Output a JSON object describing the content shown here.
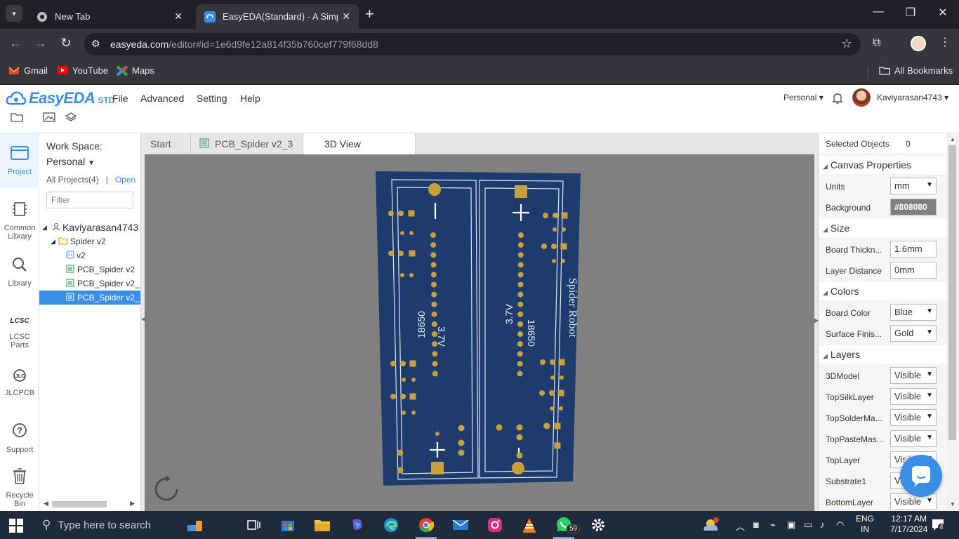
{
  "browser": {
    "tabs": [
      {
        "title": "New Tab",
        "active": false
      },
      {
        "title": "EasyEDA(Standard) - A Simple a",
        "active": true
      }
    ],
    "url_host": "easyeda.com",
    "url_path": "/editor#id=1e6d9fe12a814f35b760cef779f68dd8",
    "bookmarks": [
      "Gmail",
      "YouTube",
      "Maps"
    ],
    "all_bookmarks": "All Bookmarks"
  },
  "app": {
    "logo": "EasyEDA",
    "edition": "STD",
    "menu": [
      "File",
      "Advanced",
      "Setting",
      "Help"
    ],
    "workspace_mode": "Personal",
    "username": "Kaviyarasan4743"
  },
  "rail": [
    {
      "label": "Project",
      "icon": "folder-window-icon"
    },
    {
      "label": "Common Library",
      "icon": "component-icon"
    },
    {
      "label": "Library",
      "icon": "magnifier-icon"
    },
    {
      "label": "LCSC Parts",
      "icon": "lcsc-logo-icon"
    },
    {
      "label": "JLCPCB",
      "icon": "jlc-logo-icon"
    },
    {
      "label": "Support",
      "icon": "help-bubble-icon"
    },
    {
      "label": "Recycle Bin",
      "icon": "trash-icon"
    }
  ],
  "project_panel": {
    "workspace_label": "Work Space:",
    "workspace_value": "Personal",
    "all_projects": "All Projects(4)",
    "separator": "|",
    "open_link": "Open",
    "filter_placeholder": "Filter",
    "tree": [
      {
        "label": "Kaviyarasan4743",
        "kind": "user"
      },
      {
        "label": "Spider v2",
        "kind": "folder"
      },
      {
        "label": "v2",
        "kind": "schematic"
      },
      {
        "label": "PCB_Spider v2",
        "kind": "pcb"
      },
      {
        "label": "PCB_Spider v2_",
        "kind": "pcb"
      },
      {
        "label": "PCB_Spider v2_",
        "kind": "pcb",
        "selected": true
      }
    ]
  },
  "doc_tabs": [
    {
      "label": "Start"
    },
    {
      "label": "PCB_Spider v2_3"
    },
    {
      "label": "3D View",
      "active": true
    }
  ],
  "pcb_view": {
    "board_color": "#1e3b6e",
    "pad_color": "#c8a13a",
    "silk": {
      "left_cell": "18650",
      "left_volt": "3.7V",
      "right_cell": "18650",
      "right_volt": "3.7V",
      "title": "Spider Robot"
    }
  },
  "right_panel": {
    "selected_label": "Selected Objects",
    "selected_count": "0",
    "canvas_title": "Canvas Properties",
    "units_label": "Units",
    "units_value": "mm",
    "background_label": "Background",
    "background_value": "#808080",
    "size_title": "Size",
    "thickness_label": "Board Thickn...",
    "thickness_value": "1.6mm",
    "layer_distance_label": "Layer Distance",
    "layer_distance_value": "0mm",
    "colors_title": "Colors",
    "board_color_label": "Board Color",
    "board_color_value": "Blue",
    "surface_label": "Surface Finis...",
    "surface_value": "Gold",
    "layers_title": "Layers",
    "layers": [
      {
        "name": "3DModel",
        "value": "Visible"
      },
      {
        "name": "TopSilkLayer",
        "value": "Visible"
      },
      {
        "name": "TopSolderMa...",
        "value": "Visible"
      },
      {
        "name": "TopPasteMas...",
        "value": "Visible"
      },
      {
        "name": "TopLayer",
        "value": "Visible"
      },
      {
        "name": "Substrate1",
        "value": "Visible"
      },
      {
        "name": "BottomLayer",
        "value": "Visible"
      }
    ]
  },
  "taskbar": {
    "search_placeholder": "Type here to search",
    "whatsapp_badge": "59",
    "lang_top": "ENG",
    "lang_bottom": "IN",
    "time": "12:17 AM",
    "date": "7/17/2024",
    "notif_count": "4"
  }
}
